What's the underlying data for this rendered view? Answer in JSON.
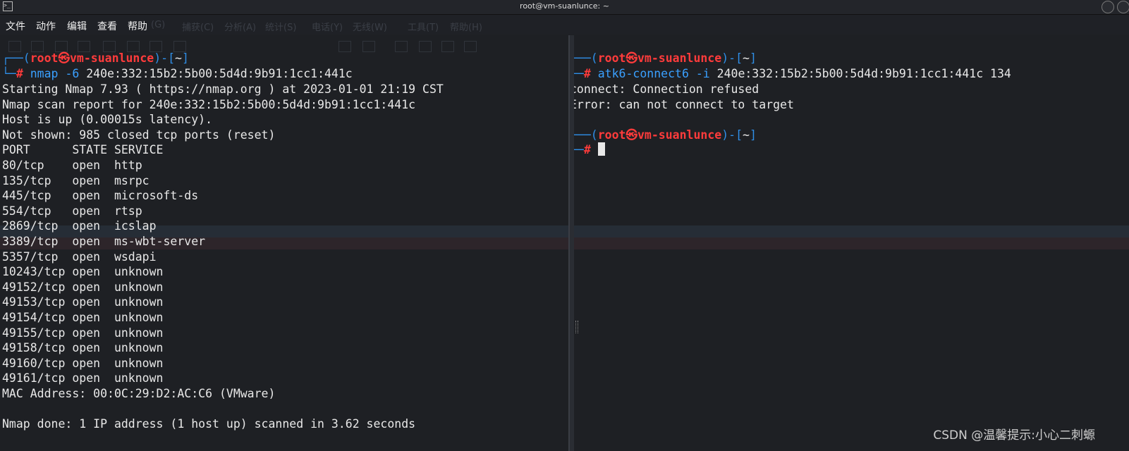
{
  "window": {
    "title": "root@vm-suanlunce: ~"
  },
  "menu": [
    "文件",
    "动作",
    "编辑",
    "查看",
    "帮助"
  ],
  "ghost_menu": [
    "(G)",
    "捕获(C)",
    "分析(A)",
    "统计(S)",
    "电话(Y)",
    "无线(W)",
    "工具(T)",
    "帮助(H)"
  ],
  "left": {
    "prompt": {
      "user": "root㉿vm-suanlunce",
      "dir": "~"
    },
    "command": {
      "name": "nmap",
      "flag": "-6",
      "args": "240e:332:15b2:5b00:5d4d:9b91:1cc1:441c"
    },
    "output": [
      "Starting Nmap 7.93 ( https://nmap.org ) at 2023-01-01 21:19 CST",
      "Nmap scan report for 240e:332:15b2:5b00:5d4d:9b91:1cc1:441c",
      "Host is up (0.00015s latency).",
      "Not shown: 985 closed tcp ports (reset)",
      "PORT      STATE SERVICE",
      "80/tcp    open  http",
      "135/tcp   open  msrpc",
      "445/tcp   open  microsoft-ds",
      "554/tcp   open  rtsp",
      "2869/tcp  open  icslap",
      "3389/tcp  open  ms-wbt-server",
      "5357/tcp  open  wsdapi",
      "10243/tcp open  unknown",
      "49152/tcp open  unknown",
      "49153/tcp open  unknown",
      "49154/tcp open  unknown",
      "49155/tcp open  unknown",
      "49158/tcp open  unknown",
      "49160/tcp open  unknown",
      "49161/tcp open  unknown",
      "MAC Address: 00:0C:29:D2:AC:C6 (VMware)",
      "",
      "Nmap done: 1 IP address (1 host up) scanned in 3.62 seconds"
    ]
  },
  "right": {
    "prompt1": {
      "user": "root㉿vm-suanlunce",
      "dir": "~"
    },
    "command": {
      "name": "atk6-connect6",
      "flag": "-i",
      "args": "240e:332:15b2:5b00:5d4d:9b91:1cc1:441c 134"
    },
    "output": [
      "connect: Connection refused",
      "Error: can not connect to target"
    ],
    "prompt2": {
      "user": "root㉿vm-suanlunce",
      "dir": "~"
    }
  },
  "watermark": "CSDN @温馨提示:小心二刺螈",
  "colors": {
    "prompt_frame": "#2f8fe8",
    "user": "#ff3b3b",
    "command": "#3aa0ff",
    "text": "#e8e8e8",
    "background": "#1e2024"
  }
}
